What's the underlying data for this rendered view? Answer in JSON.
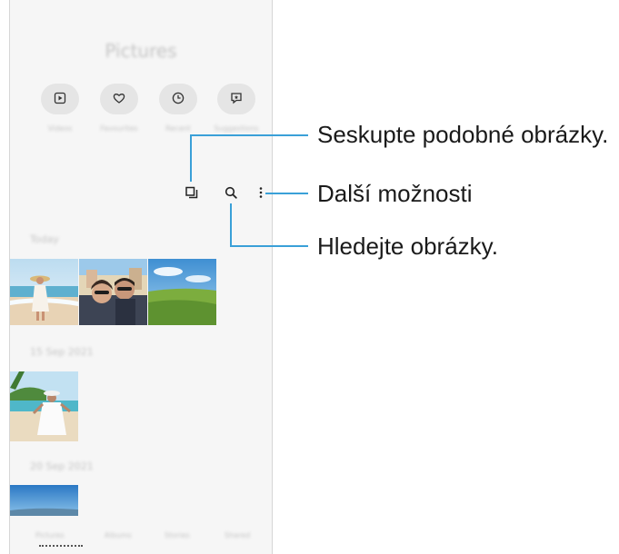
{
  "app": {
    "title": "Pictures"
  },
  "quick_buttons": [
    {
      "icon": "video-icon",
      "label": "Videos"
    },
    {
      "icon": "heart-icon",
      "label": "Favourites"
    },
    {
      "icon": "clock-icon",
      "label": "Recent"
    },
    {
      "icon": "stories-icon",
      "label": "Suggestions"
    }
  ],
  "sections": [
    {
      "title": "Today"
    },
    {
      "title": "15 Sep 2021"
    },
    {
      "title": "20 Sep 2021"
    }
  ],
  "bottom_tabs": [
    "Pictures",
    "Albums",
    "Stories",
    "Shared"
  ],
  "callouts": {
    "group_similar": "Seskupte podobné obrázky.",
    "more_options": "Další možnosti",
    "search": "Hledejte obrázky."
  },
  "colors": {
    "leader": "#3aa0d8",
    "screen_bg": "#f6f6f6",
    "button_bg": "#e5e5e5"
  }
}
